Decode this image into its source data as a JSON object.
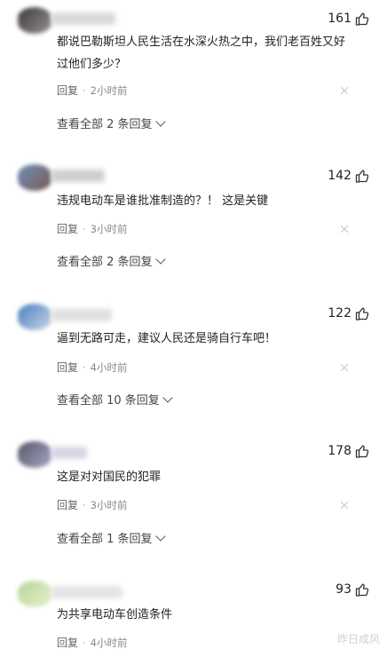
{
  "comments": [
    {
      "likes": "161",
      "text": "都说巴勒斯坦人民生活在水深火热之中，我们老百姓又好过他们多少？",
      "reply": "回复",
      "time": "2小时前",
      "view_all": "查看全部 2 条回复"
    },
    {
      "likes": "142",
      "text": "违规电动车是谁批准制造的？！ 这是关键",
      "reply": "回复",
      "time": "3小时前",
      "view_all": "查看全部 2 条回复"
    },
    {
      "likes": "122",
      "text": "逼到无路可走，建议人民还是骑自行车吧！",
      "reply": "回复",
      "time": "4小时前",
      "view_all": "查看全部 10 条回复"
    },
    {
      "likes": "178",
      "text": "这是对对国民的犯罪",
      "reply": "回复",
      "time": "3小时前",
      "view_all": "查看全部 1 条回复"
    },
    {
      "likes": "93",
      "text": "为共享电动车创造条件",
      "reply": "回复",
      "time": "4小时前"
    }
  ],
  "watermark": "昨日成风",
  "icons": {
    "like": "thumbs-up-icon",
    "close": "close-icon",
    "chevron": "chevron-down-icon"
  }
}
